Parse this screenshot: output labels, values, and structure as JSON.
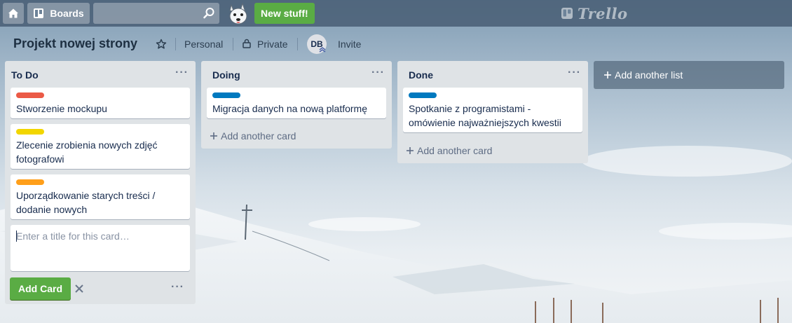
{
  "header": {
    "boards_label": "Boards",
    "search_value": "",
    "new_stuff_label": "New stuff!",
    "logo_text": "Trello"
  },
  "board": {
    "title": "Projekt nowej strony",
    "team": "Personal",
    "visibility": "Private",
    "member_initials": "DB",
    "invite_label": "Invite"
  },
  "lists": [
    {
      "title": "To Do",
      "menu": "···",
      "cards": [
        {
          "label_color": "#eb5a46",
          "text": "Stworzenie mockupu"
        },
        {
          "label_color": "#f2d600",
          "text": "Zlecenie zrobienia nowych zdjęć fotografowi"
        },
        {
          "label_color": "#ff9f1a",
          "text": "Uporządkowanie starych treści / dodanie nowych"
        }
      ],
      "composer": {
        "placeholder": "Enter a title for this card…",
        "add_button": "Add Card",
        "menu": "···"
      }
    },
    {
      "title": "Doing",
      "menu": "···",
      "cards": [
        {
          "label_color": "#0079bf",
          "text": "Migracja danych na nową platformę"
        }
      ],
      "add_card": "Add another card"
    },
    {
      "title": "Done",
      "menu": "···",
      "cards": [
        {
          "label_color": "#0079bf",
          "text": "Spotkanie z programistami - omówienie najważniejszych kwestii"
        }
      ],
      "add_card": "Add another card"
    }
  ],
  "add_list_label": "Add another list",
  "icons": {
    "home": "home-icon",
    "boards": "boards-icon",
    "search": "search-icon",
    "star": "star-icon",
    "lock": "lock-icon",
    "plus": "plus-icon",
    "close": "close-icon"
  }
}
